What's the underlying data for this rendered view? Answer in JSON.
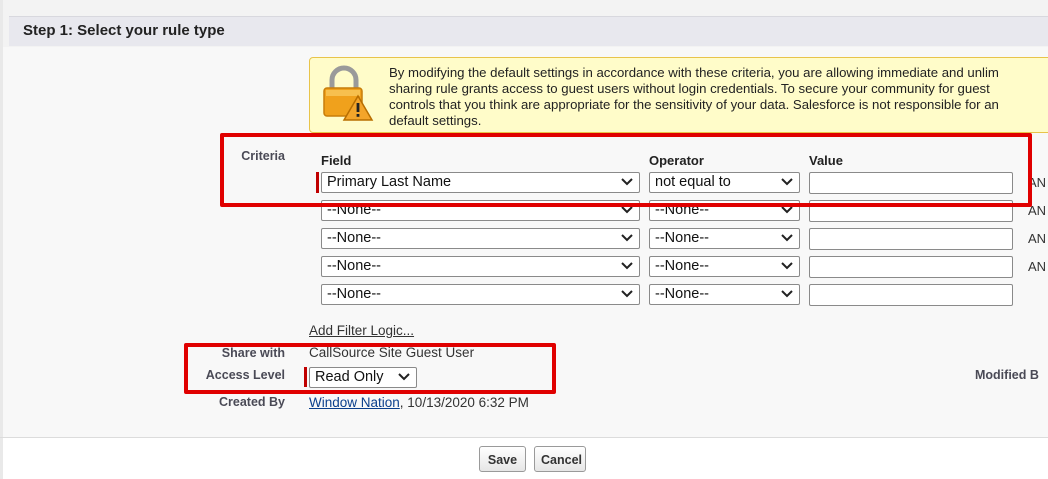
{
  "section": {
    "title": "Step 1: Select your rule type"
  },
  "warning": {
    "icon": "lock-warning-icon",
    "lines": [
      "By modifying the default settings in accordance with these criteria, you are allowing immediate and unlim",
      "sharing rule grants access to guest users without login credentials. To secure your community for guest",
      "controls that you think are appropriate for the sensitivity of your data. Salesforce is not responsible for an",
      "default settings."
    ]
  },
  "criteria": {
    "label": "Criteria",
    "headers": {
      "field": "Field",
      "operator": "Operator",
      "value": "Value"
    },
    "rows": [
      {
        "field": "Primary Last Name",
        "operator": "not equal to",
        "value": "",
        "conj": "AN"
      },
      {
        "field": "--None--",
        "operator": "--None--",
        "value": "",
        "conj": "AN"
      },
      {
        "field": "--None--",
        "operator": "--None--",
        "value": "",
        "conj": "AN"
      },
      {
        "field": "--None--",
        "operator": "--None--",
        "value": "",
        "conj": "AN"
      },
      {
        "field": "--None--",
        "operator": "--None--",
        "value": "",
        "conj": ""
      }
    ],
    "add_filter_logic": "Add Filter Logic..."
  },
  "share_with": {
    "label": "Share with",
    "value": "CallSource Site Guest User"
  },
  "access_level": {
    "label": "Access Level",
    "value": "Read Only"
  },
  "created_by": {
    "label": "Created By",
    "user": "Window Nation",
    "date": ", 10/13/2020 6:32 PM"
  },
  "modified_by": {
    "label": "Modified B"
  },
  "buttons": {
    "save": "Save",
    "cancel": "Cancel"
  },
  "colors": {
    "highlight": "#e00000",
    "required": "#c00000",
    "link": "#0b3f8c",
    "warning_bg": "#fffcc9"
  }
}
